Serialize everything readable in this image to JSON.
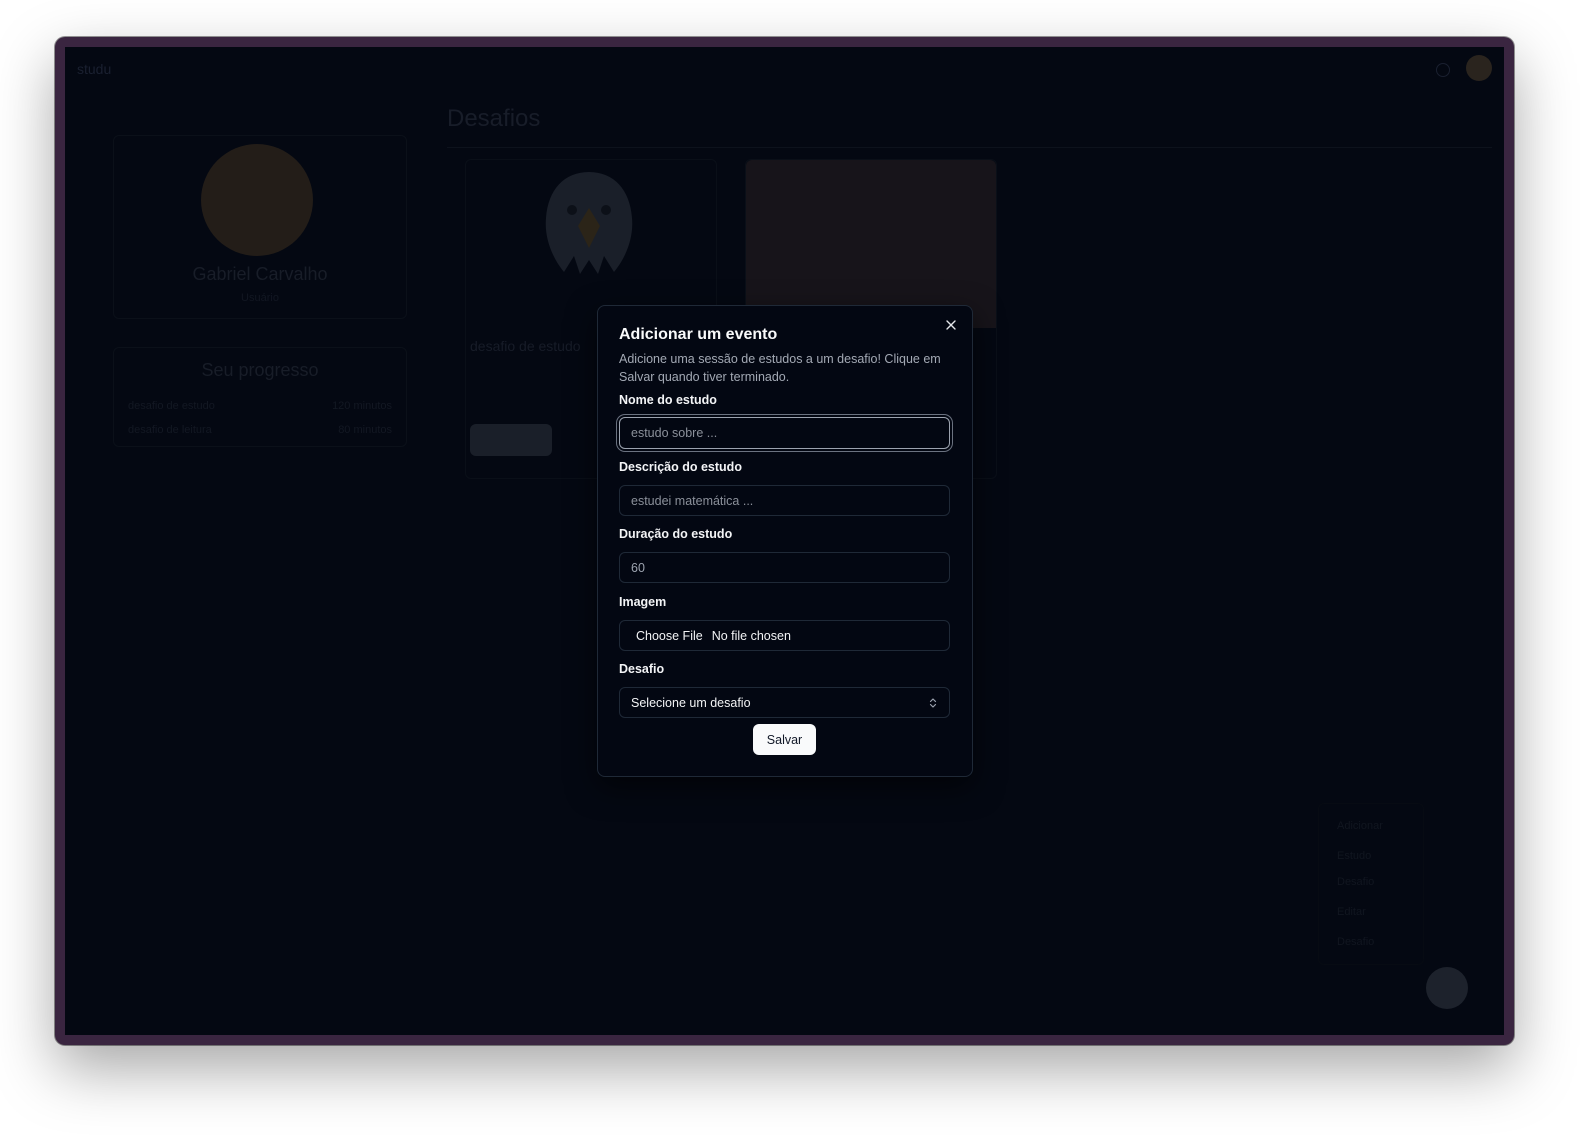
{
  "background": {
    "brand": "studu",
    "page_title": "Desafios",
    "profile": {
      "name": "Gabriel Carvalho",
      "role": "Usuário"
    },
    "progress": {
      "title": "Seu progresso",
      "rows": [
        {
          "label": "desafio de estudo",
          "value": "120 minutos"
        },
        {
          "label": "desafio de leitura",
          "value": "80 minutos"
        }
      ]
    },
    "cards": [
      {
        "title": "desafio de estudo",
        "button": "Ver desafio"
      }
    ],
    "fab_menu": {
      "heading_add": "Adicionar",
      "items_add": [
        "Estudo",
        "Desafio"
      ],
      "heading_edit": "Editar",
      "items_edit": [
        "Desafio"
      ]
    }
  },
  "modal": {
    "title": "Adicionar um evento",
    "description": "Adicione uma sessão de estudos a um desafio! Clique em Salvar quando tiver terminado.",
    "fields": {
      "name": {
        "label": "Nome do estudo",
        "placeholder": "estudo sobre ..."
      },
      "description": {
        "label": "Descrição do estudo",
        "placeholder": "estudei matemática ..."
      },
      "duration": {
        "label": "Duração do estudo",
        "value": "60"
      },
      "image": {
        "label": "Imagem",
        "button": "Choose File",
        "status": "No file chosen"
      },
      "challenge": {
        "label": "Desafio",
        "selected": "Selecione um desafio"
      }
    },
    "save_label": "Salvar",
    "close_icon": "close-icon"
  },
  "colors": {
    "overlay_bg": "#040812",
    "modal_bg": "#030712",
    "border": "#1f2937",
    "button_bg": "#f9fafb",
    "window_frame": "#3a2540"
  }
}
